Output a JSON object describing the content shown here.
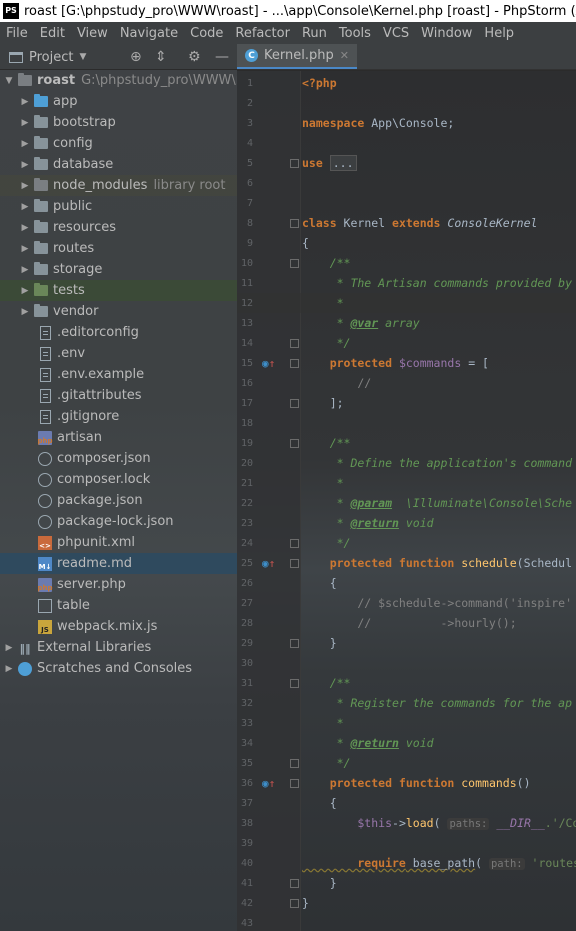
{
  "window": {
    "app_icon_text": "PS",
    "title": "roast [G:\\phpstudy_pro\\WWW\\roast] - ...\\app\\Console\\Kernel.php [roast] - PhpStorm (Administ"
  },
  "menu": [
    "File",
    "Edit",
    "View",
    "Navigate",
    "Code",
    "Refactor",
    "Run",
    "Tools",
    "VCS",
    "Window",
    "Help"
  ],
  "project_panel": {
    "title": "Project",
    "root": {
      "name": "roast",
      "path": "G:\\phpstudy_pro\\WWW\\roa"
    },
    "folders": [
      {
        "name": "app",
        "color": "#4e9fd6"
      },
      {
        "name": "bootstrap"
      },
      {
        "name": "config"
      },
      {
        "name": "database"
      },
      {
        "name": "node_modules",
        "note": "library root"
      },
      {
        "name": "public"
      },
      {
        "name": "resources"
      },
      {
        "name": "routes"
      },
      {
        "name": "storage"
      },
      {
        "name": "tests",
        "color": "#6a8759"
      },
      {
        "name": "vendor"
      }
    ],
    "files": [
      {
        "name": ".editorconfig",
        "icon": "text-file-icon"
      },
      {
        "name": ".env",
        "icon": "text-file-icon"
      },
      {
        "name": ".env.example",
        "icon": "text-file-icon"
      },
      {
        "name": ".gitattributes",
        "icon": "text-file-icon"
      },
      {
        "name": ".gitignore",
        "icon": "text-file-icon"
      },
      {
        "name": "artisan",
        "icon": "php-file-icon"
      },
      {
        "name": "composer.json",
        "icon": "json-file-icon"
      },
      {
        "name": "composer.lock",
        "icon": "json-file-icon"
      },
      {
        "name": "package.json",
        "icon": "json-file-icon"
      },
      {
        "name": "package-lock.json",
        "icon": "json-file-icon"
      },
      {
        "name": "phpunit.xml",
        "icon": "xml-file-icon"
      },
      {
        "name": "readme.md",
        "icon": "markdown-file-icon"
      },
      {
        "name": "server.php",
        "icon": "php-file-icon"
      },
      {
        "name": "table",
        "icon": "table-file-icon"
      },
      {
        "name": "webpack.mix.js",
        "icon": "js-file-icon"
      }
    ],
    "extra": [
      "External Libraries",
      "Scratches and Consoles"
    ]
  },
  "editor": {
    "tab": "Kernel.php",
    "line_numbers": [
      "1",
      "2",
      "3",
      "4",
      "5",
      "6",
      "7",
      "8",
      "9",
      "10",
      "11",
      "12",
      "13",
      "14",
      "15",
      "16",
      "17",
      "18",
      "19",
      "20",
      "21",
      "22",
      "23",
      "24",
      "25",
      "26",
      "27",
      "28",
      "29",
      "30",
      "31",
      "32",
      "33",
      "34",
      "35",
      "36",
      "37",
      "38",
      "39",
      "40",
      "41",
      "42",
      "43"
    ],
    "code": {
      "l1": "<?php",
      "l3a": "namespace",
      "l3b": " App\\Console;",
      "l5a": "use",
      "l5b": "...",
      "l8a": "class",
      "l8b": " Kernel ",
      "l8c": "extends",
      "l8d": " ConsoleKernel",
      "l9": "{",
      "l10": "    /**",
      "l11": "     * The Artisan commands provided by",
      "l12": "     *",
      "l13a": "     * ",
      "l13b": "@var",
      "l13c": " array",
      "l14": "     */",
      "l15a": "    protected",
      "l15b": " $commands",
      "l15c": " = [",
      "l16": "        //",
      "l17": "    ];",
      "l19": "    /**",
      "l20": "     * Define the application's command",
      "l21": "     *",
      "l22a": "     * ",
      "l22b": "@param",
      "l22c": "  \\Illuminate\\Console\\Sche",
      "l23a": "     * ",
      "l23b": "@return",
      "l23c": " void",
      "l24": "     */",
      "l25a": "    protected function",
      "l25b": " schedule",
      "l25c": "(Schedul",
      "l26": "    {",
      "l27a": "        // $schedule->command('inspire'",
      "l28a": "        //          ->hourly();",
      "l29": "    }",
      "l31": "    /**",
      "l32": "     * Register the commands for the ap",
      "l33": "     *",
      "l34a": "     * ",
      "l34b": "@return",
      "l34c": " void",
      "l35": "     */",
      "l36a": "    protected function",
      "l36b": " commands",
      "l36c": "()",
      "l37": "    {",
      "l38a": "        $this",
      "l38b": "->",
      "l38c": "load",
      "l38d": "(",
      "l38e": "paths:",
      "l38f": " __DIR__",
      "l38g": ".'/Co",
      "l40a": "        require",
      "l40b": " base_path",
      "l40c": "(",
      "l40d": "path:",
      "l40e": " 'routes",
      "l41": "    }",
      "l42": "}"
    }
  }
}
